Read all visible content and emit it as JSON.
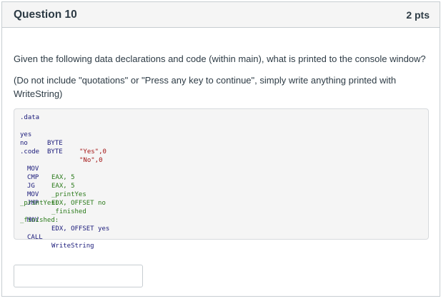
{
  "question": {
    "title": "Question 10",
    "points": "2 pts",
    "prompt": "Given the following data declarations and code (within main), what is printed to the console window?",
    "note": "(Do not include \"quotations\" or \"Press any key to continue\", simply write anything printed with WriteString)"
  },
  "code": {
    "data_dir": ".data",
    "yes_label": "yes",
    "yes_type": "BYTE",
    "yes_value": "\"Yes\",0",
    "no_label": "no",
    "no_type": "BYTE",
    "no_value": "\"No\",0",
    "code_dir": ".code",
    "l1_op": "MOV",
    "l1_arg": "EAX, 5",
    "l2_op": "CMP",
    "l2_arg": "EAX, 5",
    "l3_op": "JG",
    "l3_arg": "_printYes",
    "l4_op": "MOV",
    "l4_arg": "EDX, OFFSET no",
    "l5_op": "JMP",
    "l5_arg": "_finished",
    "label_printyes": "_printYes:",
    "l6_op": "MOV",
    "l6_arg": "EDX, OFFSET yes",
    "label_finished": "_finished:",
    "l7_op": "CALL",
    "l7_arg": "WriteString"
  },
  "answer": {
    "value": ""
  }
}
